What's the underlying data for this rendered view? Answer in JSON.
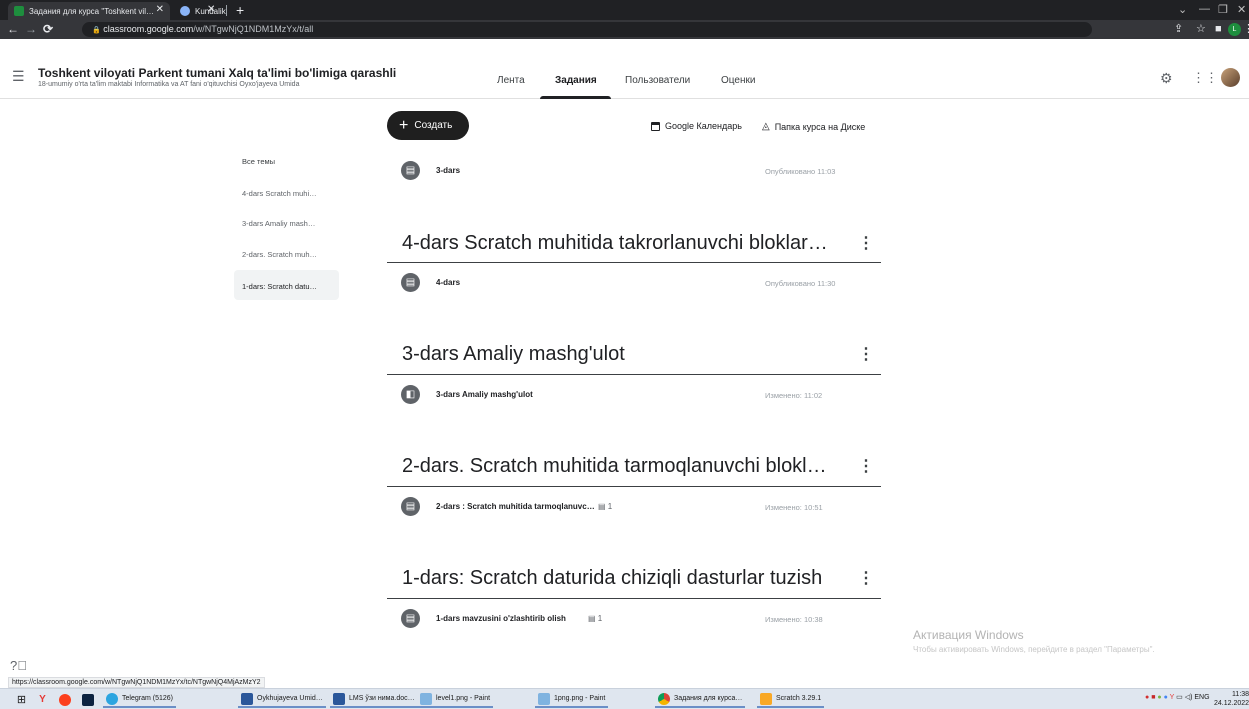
{
  "browser": {
    "tabs": [
      {
        "label": "Задания для курса \"Toshkent vil…",
        "active": true
      },
      {
        "label": "Kundalik",
        "active": false
      }
    ],
    "new_tab": "+",
    "url_host": "classroom.google.com",
    "url_path": "/w/NTgwNjQ1NDM1MzYx/t/all",
    "profile_initial": "L",
    "status_url": "https://classroom.google.com/w/NTgwNjQ1NDM1MzYx/tc/NTgwNjQ4MjAzMzY2"
  },
  "header": {
    "course_title": "Toshkent viloyati Parkent tumani Xalq ta'limi bo'limiga qarashli",
    "course_subtitle": "18-umumiy o'rta ta'lim maktabi Informatika va AT fani o'qituvchisi Oyxo'jayeva Umida",
    "tabs": [
      "Лента",
      "Задания",
      "Пользователи",
      "Оценки"
    ],
    "active_tab": "Задания"
  },
  "toolbar": {
    "create_label": "Создать",
    "calendar_label": "Google Календарь",
    "drive_label": "Папка курса на Диске"
  },
  "sidebar": {
    "all_topics": "Все темы",
    "items": [
      {
        "label": "4-dars Scratch muhi…"
      },
      {
        "label": "3-dars Amaliy mash…"
      },
      {
        "label": "2-dars. Scratch muh…"
      },
      {
        "label": "1-dars: Scratch datu…",
        "active": true
      }
    ]
  },
  "ungrouped": {
    "item": {
      "title": "3-dars",
      "status": "Опубликовано 11:03",
      "icon": "assignment-icon"
    }
  },
  "topics": [
    {
      "title": "4-dars Scratch muhitida takrorlanuvchi bloklar…",
      "item": {
        "title": "4-dars",
        "status": "Опубликовано 11:30",
        "comments": "",
        "icon": "assignment-icon"
      }
    },
    {
      "title": "3-dars Amaliy mashg'ulot",
      "item": {
        "title": "3-dars Amaliy mashg'ulot",
        "status": "Изменено: 11:02",
        "comments": "",
        "icon": "material-icon"
      }
    },
    {
      "title": "2-dars. Scratch muhitida tarmoqlanuvchi blokl…",
      "item": {
        "title": "2-dars : Scratch muhitida tarmoqlanuvc…",
        "status": "Изменено: 10:51",
        "comments": "1",
        "icon": "assignment-icon"
      }
    },
    {
      "title": "1-dars: Scratch daturida chiziqli dasturlar tuzish",
      "item": {
        "title": "1-dars mavzusini o'zlashtirib olish",
        "status": "Изменено: 10:38",
        "comments": "1",
        "icon": "assignment-icon"
      }
    }
  ],
  "watermark": {
    "line1": "Активация Windows",
    "line2": "Чтобы активировать Windows, перейдите в раздел \"Параметры\"."
  },
  "taskbar": {
    "tasks": [
      {
        "label": "Telegram (5126)",
        "color": "#2ca5e0"
      },
      {
        "label": "Oykhujayeva Umid…",
        "color": "#2b579a"
      },
      {
        "label": "LMS ўзи нима.doc…",
        "color": "#2b579a"
      },
      {
        "label": "level1.png - Paint",
        "color": "#7fb3e0"
      },
      {
        "label": "1png.png - Paint",
        "color": "#7fb3e0"
      },
      {
        "label": "Задания для курса…",
        "color": "#4285f4"
      },
      {
        "label": "Scratch 3.29.1",
        "color": "#f9a825"
      }
    ],
    "tray_lang": "ENG",
    "time": "11:38",
    "date": "24.12.2022"
  },
  "colors": {
    "primary_text": "#202124",
    "accent_dark": "#1f1f1f",
    "chrome_bg": "#202124"
  }
}
